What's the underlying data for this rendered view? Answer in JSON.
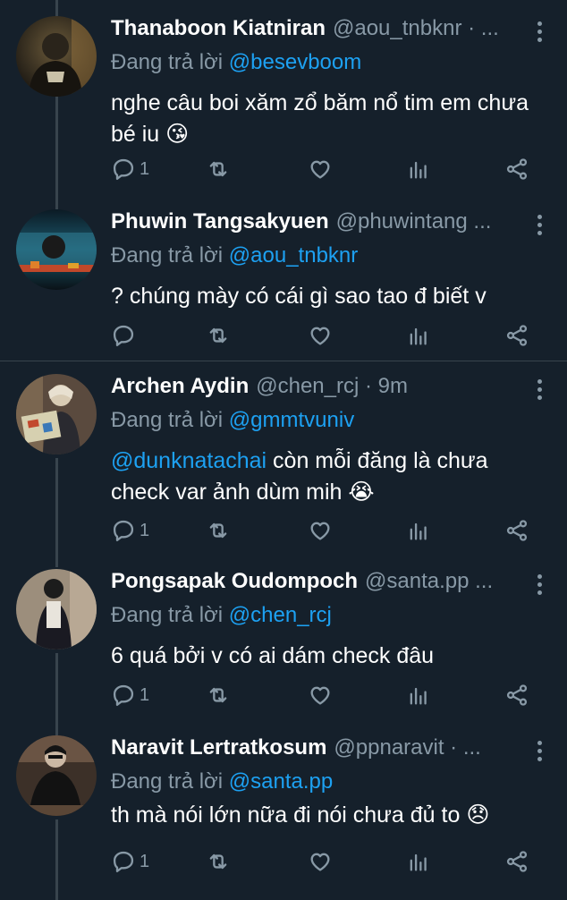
{
  "tweets": [
    {
      "name": "Thanaboon Kiatniran",
      "handle": "@aou_tnbknr · ...",
      "reply_prefix": "Đang trả lời",
      "reply_to": "@besevboom",
      "text": "nghe câu boi xăm zổ băm nổ tim em chưa bé iu",
      "emoji": "😘",
      "reply_count": "1"
    },
    {
      "name": "Phuwin Tangsakyuen",
      "handle": "@phuwintang ...",
      "reply_prefix": "Đang trả lời",
      "reply_to": "@aou_tnbknr",
      "text": "? chúng mày có cái gì sao tao đ biết v",
      "emoji": "",
      "reply_count": ""
    },
    {
      "name": "Archen Aydin",
      "handle": "@chen_rcj · 9m",
      "reply_prefix": "Đang trả lời",
      "reply_to": "@gmmtvuniv",
      "mention": "@dunknatachai",
      "text": " còn mỗi đăng là chưa check var ảnh dùm mih",
      "emoji": "😭",
      "reply_count": "1"
    },
    {
      "name": "Pongsapak Oudompoch",
      "handle": "@santa.pp ...",
      "reply_prefix": "Đang trả lời",
      "reply_to": "@chen_rcj",
      "text": "6 quá bởi v có ai dám check đâu",
      "emoji": "",
      "reply_count": "1"
    },
    {
      "name": "Naravit Lertratkosum",
      "handle": "@ppnaravit · ...",
      "reply_prefix": "Đang trả lời",
      "reply_to": "@santa.pp",
      "text": "th mà nói lớn nữa đi nói chưa đủ to",
      "emoji": "😞",
      "reply_count": "1"
    }
  ],
  "icons": {
    "reply": "reply-icon",
    "retweet": "retweet-icon",
    "like": "heart-icon",
    "analytics": "analytics-icon",
    "share": "share-icon",
    "more": "more-icon"
  },
  "colors": {
    "background": "#15202b",
    "text": "#ffffff",
    "secondary": "#8899a6",
    "link": "#1da1f2",
    "line": "#38444d"
  }
}
